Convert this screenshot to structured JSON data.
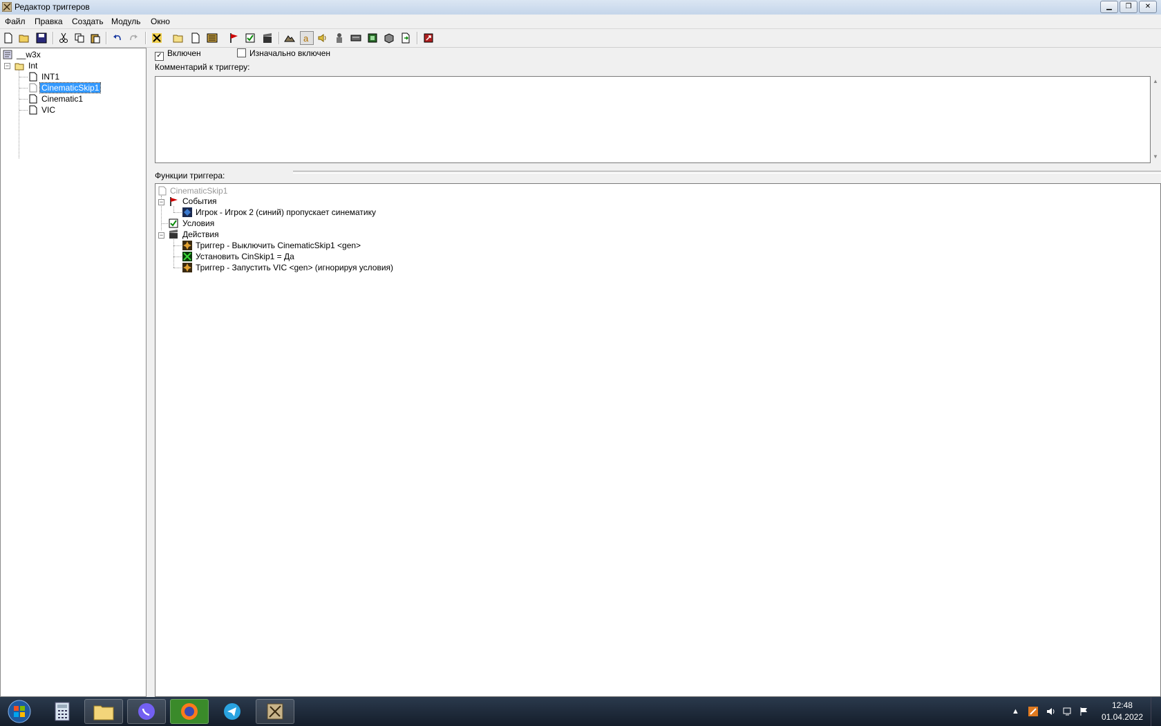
{
  "window": {
    "title": "Редактор триггеров"
  },
  "menu": [
    "Файл",
    "Правка",
    "Создать",
    "Модуль",
    "Окно"
  ],
  "tree": {
    "root": "__w3x",
    "folder": "Int",
    "items": [
      "INT1",
      "CinematicSkip1",
      "Cinematic1",
      "VIC"
    ],
    "selected": "CinematicSkip1"
  },
  "trigger": {
    "enabled_label": "Включен",
    "enabled_checked": true,
    "initially_enabled_label": "Изначально включен",
    "initially_enabled_checked": false,
    "comment_label": "Комментарий к триггеру:",
    "comment_value": "",
    "functions_label": "Функции триггера:"
  },
  "functions": {
    "root": "CinematicSkip1",
    "events_label": "События",
    "events": [
      "Игрок - Игрок 2 (синий) пропускает синематику"
    ],
    "conditions_label": "Условия",
    "actions_label": "Действия",
    "actions": [
      "Триггер - Выключить CinematicSkip1 <gen>",
      "Установить CinSkip1 = Да",
      "Триггер - Запустить VIC <gen> (игнорируя условия)"
    ]
  },
  "taskbar": {
    "clock_time": "12:48",
    "clock_date": "01.04.2022"
  },
  "colors": {
    "selection": "#3399ff",
    "events_flag": "#cc0000",
    "taskbar": "#1c2838"
  }
}
